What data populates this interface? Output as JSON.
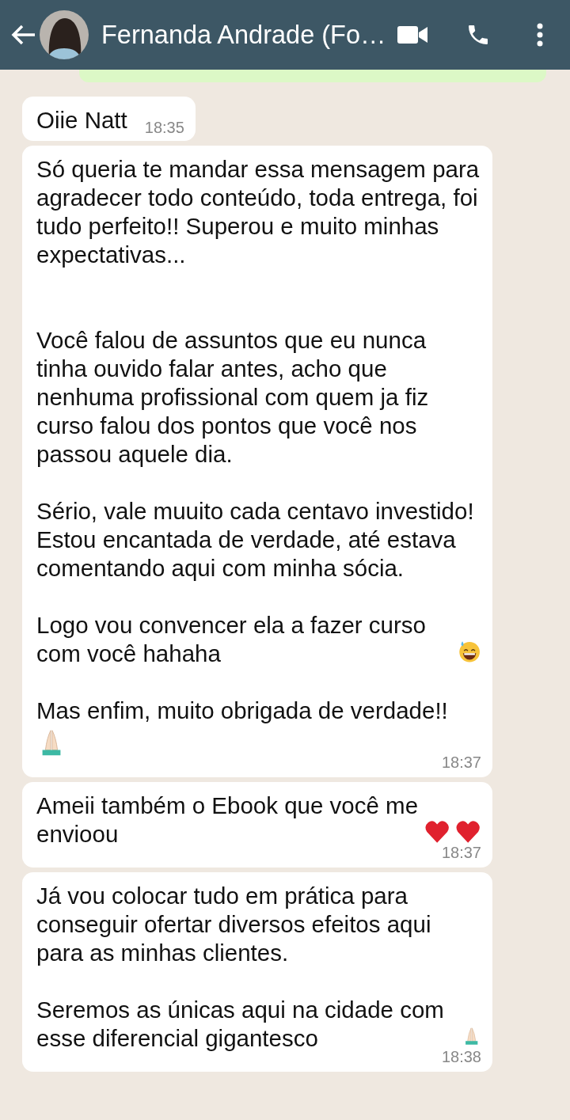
{
  "header": {
    "contact_name": "Fernanda Andrade (Fo…"
  },
  "messages": [
    {
      "kind": "sent"
    },
    {
      "kind": "received",
      "time": "18:35",
      "paragraphs": [
        {
          "text": "Oiie Natt"
        }
      ]
    },
    {
      "kind": "received",
      "time": "18:37",
      "paragraphs": [
        {
          "text": "Só queria te mandar essa mensagem para agradecer todo conteúdo, toda entrega, foi tudo perfeito!! Superou e muito minhas expectativas..."
        },
        {
          "text": "\nVocê falou de assuntos que eu nunca tinha ouvido falar antes, acho que nenhuma profissional com quem ja fiz curso falou dos pontos que você nos passou aquele dia."
        },
        {
          "text": "Sério, vale muuito cada centavo investido! Estou encantada de verdade, até estava comentando aqui com minha sócia."
        },
        {
          "text": "Logo vou convencer ela a fazer curso com você hahaha",
          "kind": "laughing"
        },
        {
          "text": "Mas enfim, muito obrigada de verdade!!",
          "kind": "pray_below"
        }
      ]
    },
    {
      "kind": "received",
      "time": "18:37",
      "paragraphs": [
        {
          "text": "Ameii também o Ebook que você me envioou",
          "kind": "hearts"
        }
      ]
    },
    {
      "kind": "received",
      "time": "18:38",
      "paragraphs": [
        {
          "text": "Já vou colocar tudo em prática para conseguir ofertar diversos efeitos aqui para as minhas clientes."
        },
        {
          "text": "Seremos as únicas aqui na cidade com esse diferencial gigantesco",
          "kind": "pray"
        }
      ]
    }
  ]
}
